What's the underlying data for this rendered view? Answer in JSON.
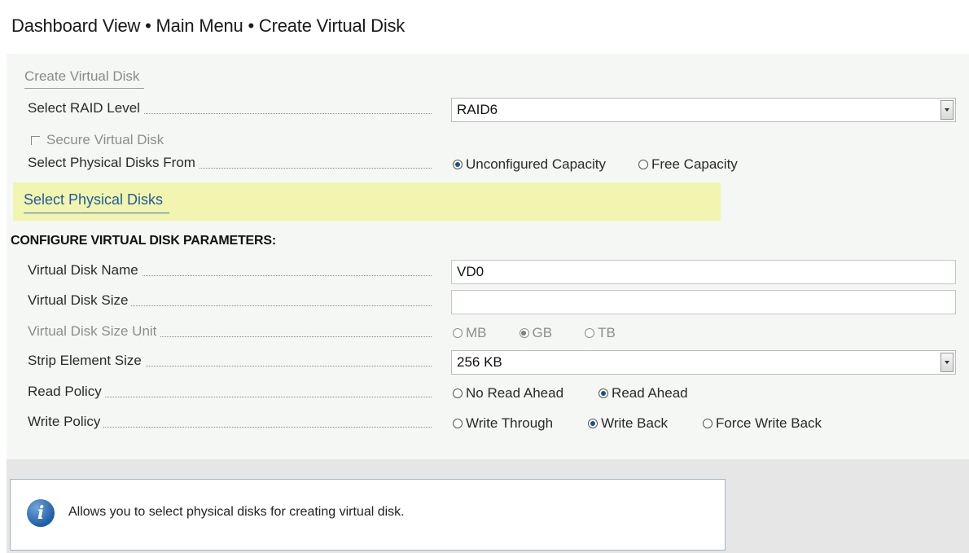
{
  "breadcrumb": "Dashboard View • Main Menu • Create Virtual Disk",
  "section_link": "Create Virtual Disk",
  "raid": {
    "label": "Select RAID Level",
    "value": "RAID6"
  },
  "secure": {
    "label": "Secure Virtual Disk",
    "checked": false
  },
  "physical_from": {
    "label": "Select Physical Disks From",
    "options": [
      "Unconfigured Capacity",
      "Free Capacity"
    ],
    "selected": "Unconfigured Capacity"
  },
  "select_disks_link": "Select Physical Disks",
  "params_heading": "CONFIGURE VIRTUAL DISK PARAMETERS:",
  "vd_name": {
    "label": "Virtual Disk Name",
    "value": "VD0"
  },
  "vd_size": {
    "label": "Virtual Disk Size",
    "value": ""
  },
  "size_unit": {
    "label": "Virtual Disk Size Unit",
    "options": [
      "MB",
      "GB",
      "TB"
    ],
    "selected": "GB"
  },
  "strip": {
    "label": "Strip Element Size",
    "value": "256 KB"
  },
  "read_policy": {
    "label": "Read Policy",
    "options": [
      "No Read Ahead",
      "Read Ahead"
    ],
    "selected": "Read Ahead"
  },
  "write_policy": {
    "label": "Write Policy",
    "options": [
      "Write Through",
      "Write Back",
      "Force Write Back"
    ],
    "selected": "Write Back"
  },
  "help_text": "Allows you to select physical disks for creating virtual disk.",
  "icons": {
    "info": "info-icon",
    "dropdown": "chevron-down-icon"
  },
  "colors": {
    "highlight": "#f2f5b0",
    "link": "#1f5b9e",
    "radio_selected": "#1c4f8c"
  }
}
